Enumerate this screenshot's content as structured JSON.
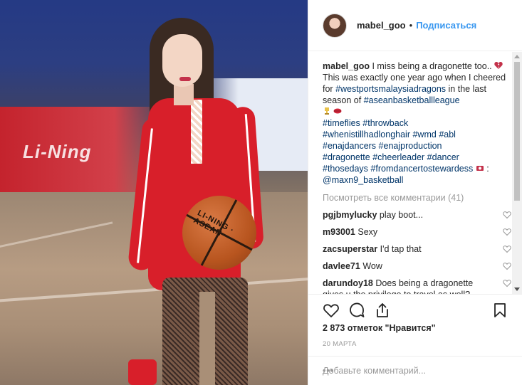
{
  "post": {
    "username": "mabel_goo",
    "separator": "•",
    "follow_label": "Подписаться"
  },
  "photo": {
    "ad_text": "Li-Ning",
    "ball_brand": "LI-NING · ASEAN"
  },
  "caption": {
    "username": "mabel_goo",
    "text_1": "I miss being a dragonette too..",
    "text_2": "This was exactly one year ago when I cheered for",
    "tag_1": "#westportsmalaysiadragons",
    "text_3": "in the last season of",
    "tag_2": "#aseanbasketballleague",
    "hashtags": [
      "#timeflies",
      "#throwback",
      "#whenistillhadlonghair",
      "#wmd",
      "#abl",
      "#enajdancers",
      "#enajproduction",
      "#dragonette",
      "#cheerleader",
      "#dancer",
      "#thosedays",
      "#fromdancertostewardess"
    ],
    "mention_sep": ":",
    "mention": "@maxn9_basketball"
  },
  "view_all_comments": "Посмотреть все комментарии (41)",
  "comments": [
    {
      "user": "pgjbmylucky",
      "text": "play boot..."
    },
    {
      "user": "m93001",
      "text": "Sexy"
    },
    {
      "user": "zacsuperstar",
      "text": "I'd tap that"
    },
    {
      "user": "davlee71",
      "text": "Wow"
    },
    {
      "user": "darundoy18",
      "text": "Does being a dragonette gives u the privilege to travel as well?"
    }
  ],
  "likes_text": "2 873 отметок \"Нравится\"",
  "date_text": "20 МАРТА",
  "add_comment_placeholder": "Добавьте комментарий...",
  "more_label": "•••",
  "icons": {
    "like": "heart-icon",
    "comment": "comment-icon",
    "share": "share-icon",
    "save": "bookmark-icon"
  },
  "colors": {
    "link_blue": "#3897f0",
    "tag_blue": "#003569",
    "muted_gray": "#999999",
    "text_dark": "#262626",
    "border": "#efefef"
  }
}
